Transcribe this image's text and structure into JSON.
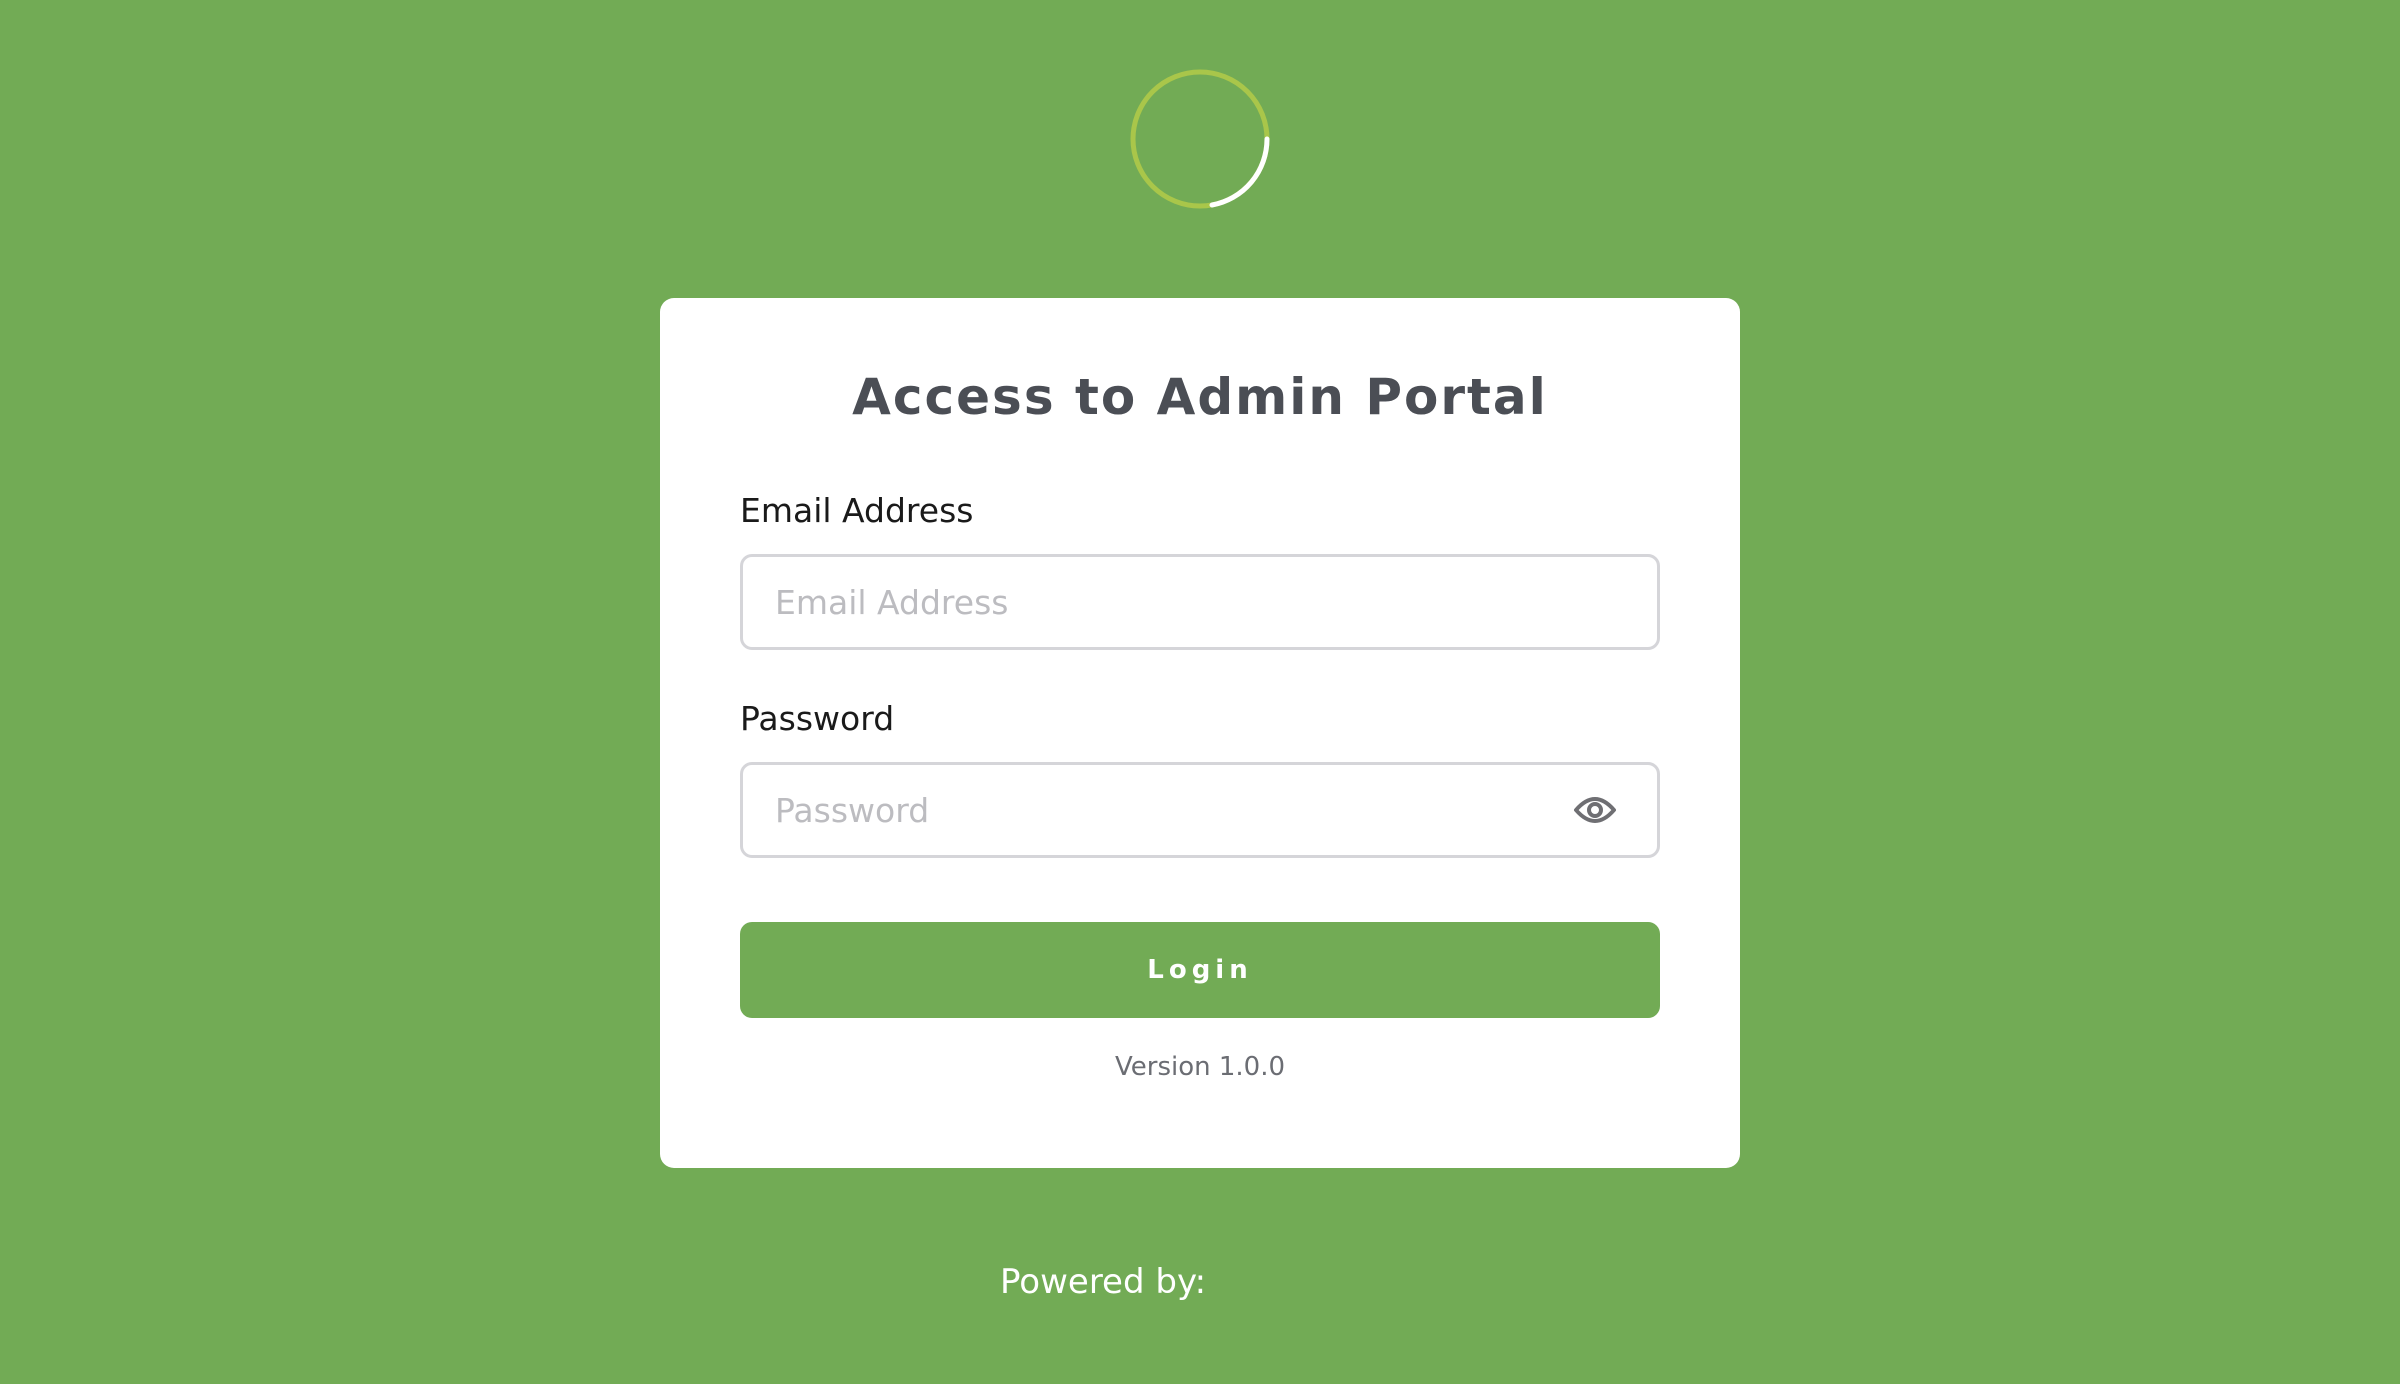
{
  "loading_spinner": {
    "icon": "loading-spinner-icon",
    "track_color": "#a9c64a",
    "arc_color": "#ffffff"
  },
  "login_card": {
    "title": "Access to Admin Portal",
    "email": {
      "label": "Email Address",
      "placeholder": "Email Address",
      "value": ""
    },
    "password": {
      "label": "Password",
      "placeholder": "Password",
      "value": "",
      "toggle_icon": "eye-icon"
    },
    "login_button_label": "Login",
    "version": "Version 1.0.0"
  },
  "footer": {
    "powered_by": "Powered by:"
  },
  "colors": {
    "background": "#72ab55",
    "primary_button": "#72ab55",
    "card": "#ffffff",
    "title_text": "#4b4e55"
  }
}
